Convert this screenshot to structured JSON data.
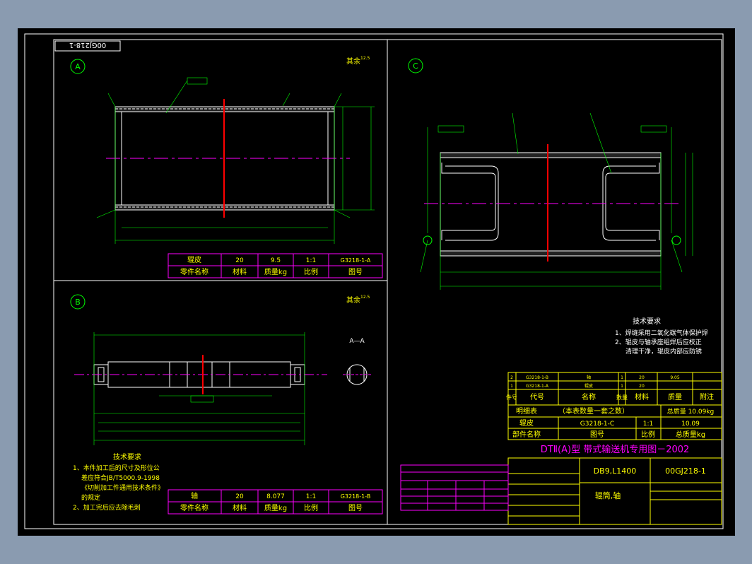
{
  "drawing": {
    "stamp": "00GJ218-1",
    "section_labels": [
      "A",
      "B",
      "C"
    ],
    "rough_note": "其余",
    "rough_value": "12.5",
    "sectionAA": "A—A"
  },
  "viewA": {
    "table": {
      "row1": [
        "辊皮",
        "20",
        "9.5",
        "1:1",
        "G3218-1-A"
      ],
      "row2": [
        "零件名称",
        "材料",
        "质量kg",
        "比例",
        "图号"
      ]
    }
  },
  "viewB": {
    "tech_title": "技术要求",
    "tech_lines": [
      "1、本件加工后的尺寸及形位公",
      "差应符合JB/T5000.9-1998",
      "《切削加工件通用技术条件》",
      "的规定",
      "2、加工完后应去除毛刺"
    ],
    "table": {
      "row1": [
        "轴",
        "20",
        "8.077",
        "1:1",
        "G3218-1-B"
      ],
      "row2": [
        "零件名称",
        "材料",
        "质量kg",
        "比例",
        "图号"
      ]
    }
  },
  "viewC": {
    "tech_title": "技术要求",
    "tech_lines": [
      "1、焊缝采用二氧化碳气体保护焊",
      "2、辊皮与轴承座组焊后应校正",
      "清理干净，辊皮内部应防锈"
    ]
  },
  "title_block": {
    "parts": [
      [
        "2",
        "G3218-1-B",
        "轴",
        "1",
        "20",
        "9.05",
        ""
      ],
      [
        "1",
        "G3218-1-A",
        "辊皮",
        "1",
        "20",
        "",
        ""
      ]
    ],
    "header": [
      "件号",
      "代号",
      "名称",
      "数量",
      "材料",
      "质量",
      "附注"
    ],
    "detail_row": [
      "明细表",
      "（本表数量一套之数）",
      "总质量 10.09kg"
    ],
    "assembly_row": [
      "辊皮",
      "G3218-1-C",
      "1:1",
      "10.09"
    ],
    "assembly_header": [
      "部件名称",
      "图号",
      "比例",
      "总质量kg"
    ],
    "banner": "DTⅡ(A)型 带式输送机专用图－2002",
    "model": "DB9,L1400",
    "drawing_no": "00GJ218-1",
    "part_name": "辊筒,轴"
  }
}
